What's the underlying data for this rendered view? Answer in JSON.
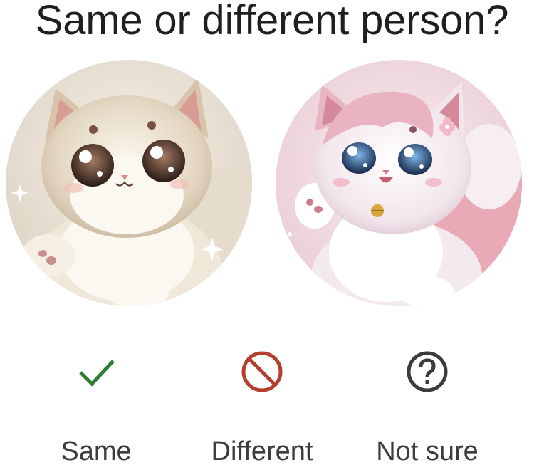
{
  "question": "Same or different person?",
  "images": {
    "left": {
      "icon": "beige-kitten-portrait"
    },
    "right": {
      "icon": "pink-kitten-portrait"
    }
  },
  "choices": [
    {
      "label": "Same",
      "icon": "check-icon",
      "color": "#2e7d32"
    },
    {
      "label": "Different",
      "icon": "block-icon",
      "color": "#b3402f"
    },
    {
      "label": "Not sure",
      "icon": "help-circle-icon",
      "color": "#3c3c3c"
    }
  ]
}
